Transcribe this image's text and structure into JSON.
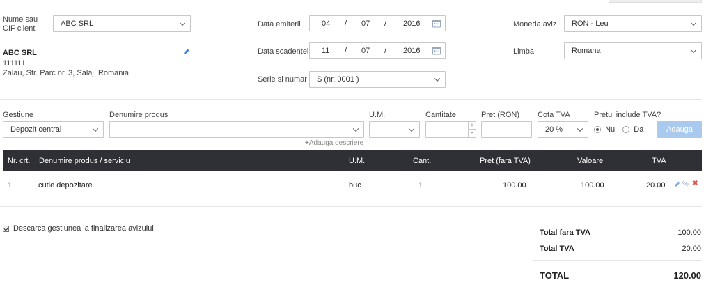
{
  "client": {
    "label": "Nume sau CIF client",
    "selected": "ABC SRL",
    "name": "ABC SRL",
    "cif": "111111",
    "address": "Zalau, Str. Parc nr. 3, Salaj, Romania"
  },
  "dates": {
    "issue_label": "Data emiterii",
    "issue": {
      "day": "04",
      "month": "07",
      "year": "2016"
    },
    "due_label": "Data scadentei",
    "due": {
      "day": "11",
      "month": "07",
      "year": "2016"
    },
    "separator": "/"
  },
  "series": {
    "label": "Serie si numar",
    "selected": "S (nr. 0001 )"
  },
  "currency": {
    "label": "Moneda aviz",
    "selected": "RON - Leu"
  },
  "language": {
    "label": "Limba",
    "selected": "Romana"
  },
  "product_form": {
    "gestiune_label": "Gestiune",
    "gestiune_value": "Depozit central",
    "product_label": "Denumire produs",
    "product_value": "",
    "um_label": "U.M.",
    "um_value": "",
    "qty_label": "Cantitate",
    "qty_value": "",
    "price_label": "Pret (RON)",
    "price_value": "",
    "vat_label": "Cota TVA",
    "vat_value": "20 %",
    "vat_included_label": "Pretul include TVA?",
    "opt_no": "Nu",
    "opt_yes": "Da",
    "add_button": "Adauga",
    "add_description": "Adauga descriere",
    "stepper_up": "+",
    "stepper_down": "-"
  },
  "table": {
    "headers": {
      "nr": "Nr. crt.",
      "name": "Denumire produs / serviciu",
      "um": "U.M.",
      "qty": "Cant.",
      "price": "Pret (fara TVA)",
      "value": "Valoare",
      "vat": "TVA"
    },
    "rows": [
      {
        "nr": "1",
        "name": "cutie depozitare",
        "um": "buc",
        "qty": "1",
        "price": "100.00",
        "value": "100.00",
        "vat": "20.00",
        "percent": "%",
        "remove": "✖"
      }
    ]
  },
  "footer": {
    "stock_checkbox": "Descarca gestiunea la finalizarea avizului",
    "totals": {
      "net_label": "Total fara TVA",
      "net": "100.00",
      "vat_label": "Total TVA",
      "vat": "20.00",
      "total_label": "TOTAL",
      "total": "120.00"
    }
  },
  "colors": {
    "header_bg": "#2f3036",
    "add_button": "#a9c9ee",
    "edit_icon": "#3a7bd5",
    "remove_icon": "#d9534f"
  }
}
